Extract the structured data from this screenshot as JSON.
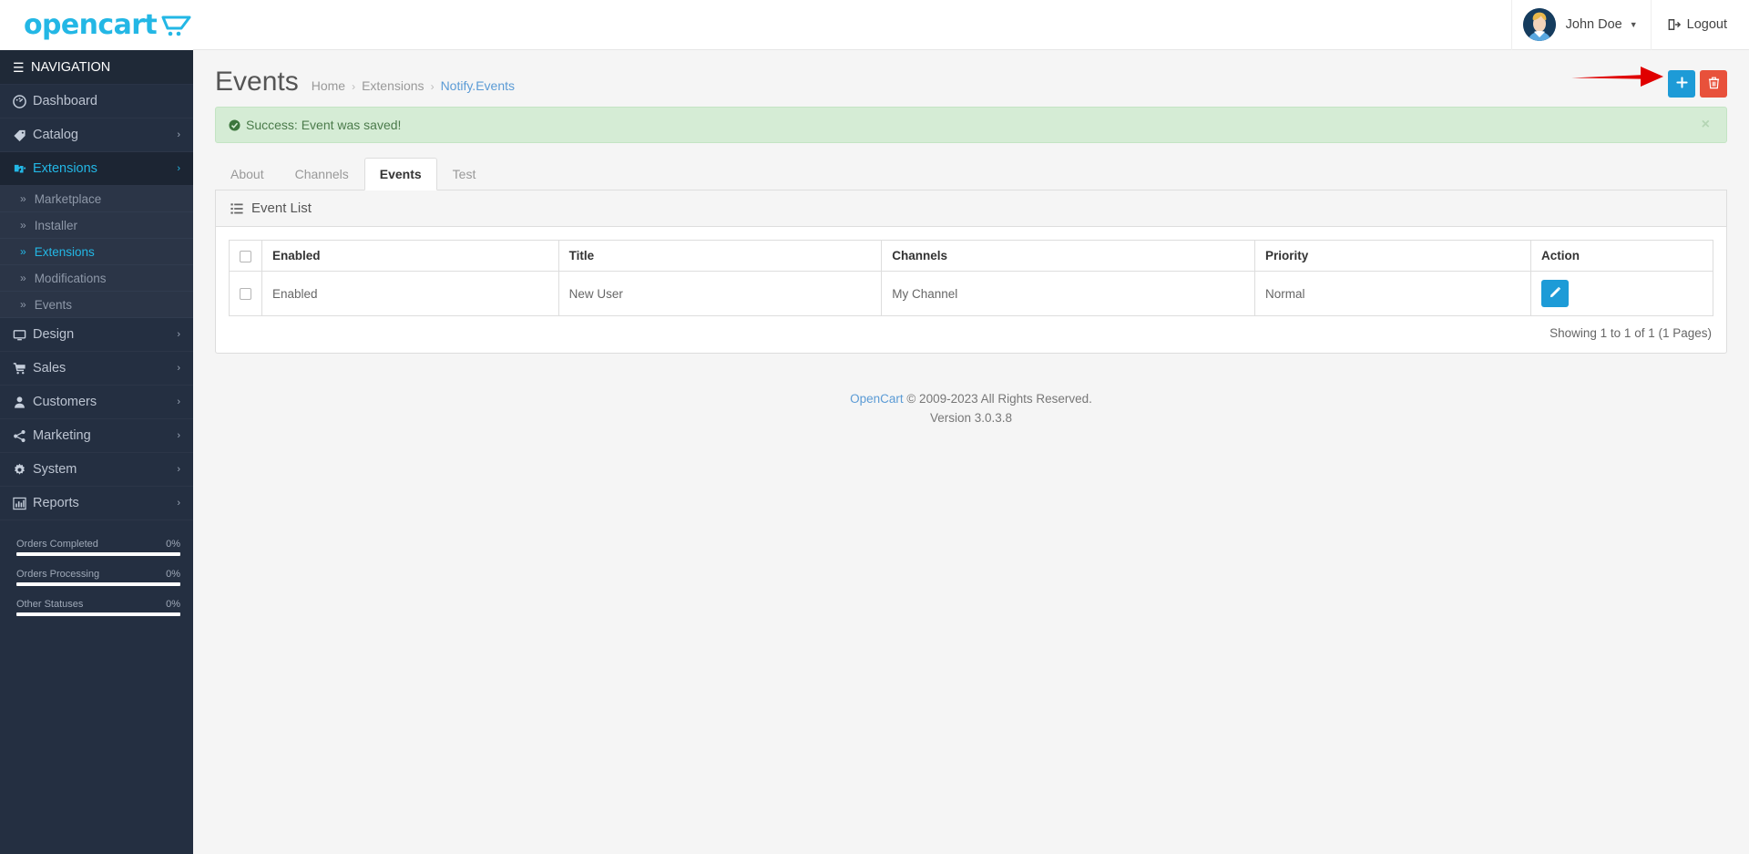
{
  "brand": {
    "logo_text": "opencart",
    "accent_color": "#23b7e5"
  },
  "sidebar": {
    "nav_header": "NAVIGATION",
    "items": [
      {
        "label": "Dashboard",
        "icon": "dashboard-icon",
        "caret": "",
        "active": false
      },
      {
        "label": "Catalog",
        "icon": "tag-icon",
        "caret": "›",
        "active": false
      },
      {
        "label": "Extensions",
        "icon": "puzzle-icon",
        "caret": "›",
        "active": true
      },
      {
        "label": "Design",
        "icon": "monitor-icon",
        "caret": "›",
        "active": false
      },
      {
        "label": "Sales",
        "icon": "cart-icon",
        "caret": "›",
        "active": false
      },
      {
        "label": "Customers",
        "icon": "user-icon",
        "caret": "›",
        "active": false
      },
      {
        "label": "Marketing",
        "icon": "share-icon",
        "caret": "›",
        "active": false
      },
      {
        "label": "System",
        "icon": "gear-icon",
        "caret": "›",
        "active": false
      },
      {
        "label": "Reports",
        "icon": "bar-chart-icon",
        "caret": "›",
        "active": false
      }
    ],
    "sub_items": [
      {
        "label": "Marketplace",
        "active": false
      },
      {
        "label": "Installer",
        "active": false
      },
      {
        "label": "Extensions",
        "active": true
      },
      {
        "label": "Modifications",
        "active": false
      },
      {
        "label": "Events",
        "active": false
      }
    ],
    "stats": [
      {
        "label": "Orders Completed",
        "value": "0%",
        "percent": 0
      },
      {
        "label": "Orders Processing",
        "value": "0%",
        "percent": 0
      },
      {
        "label": "Other Statuses",
        "value": "0%",
        "percent": 0
      }
    ]
  },
  "topbar": {
    "user_name": "John Doe",
    "logout_label": "Logout"
  },
  "page": {
    "title": "Events",
    "breadcrumb": [
      {
        "label": "Home",
        "last": false
      },
      {
        "label": "Extensions",
        "last": false
      },
      {
        "label": "Notify.Events",
        "last": true
      }
    ],
    "separator": "›",
    "add_button_label": "+",
    "delete_button_label": "delete",
    "add_button_color": "#1d9bd7",
    "delete_button_color": "#e8513b",
    "annotation_arrow_color": "#e00000"
  },
  "alert": {
    "message": "Success: Event was saved!",
    "close_label": "×",
    "type": "success"
  },
  "tabs": [
    {
      "label": "About",
      "active": false
    },
    {
      "label": "Channels",
      "active": false
    },
    {
      "label": "Events",
      "active": true
    },
    {
      "label": "Test",
      "active": false
    }
  ],
  "panel": {
    "heading": "Event List"
  },
  "table": {
    "columns": [
      "",
      "Enabled",
      "Title",
      "Channels",
      "Priority",
      "Action"
    ],
    "rows": [
      {
        "enabled": "Enabled",
        "title": "New User",
        "channels": "My Channel",
        "priority": "Normal",
        "action": "edit"
      }
    ],
    "showing": "Showing 1 to 1 of 1 (1 Pages)"
  },
  "footer": {
    "brand_link": "OpenCart",
    "copyright": " © 2009-2023 All Rights Reserved.",
    "version": "Version 3.0.3.8"
  }
}
